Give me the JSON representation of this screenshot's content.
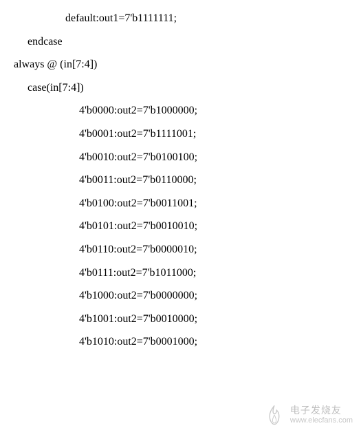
{
  "code": {
    "lines": [
      {
        "indent": 3,
        "text": "default:out1=7'b1111111;"
      },
      {
        "indent": 2,
        "text": "endcase"
      },
      {
        "indent": 1,
        "text": "always @ (in[7:4])"
      },
      {
        "indent": 2,
        "text": "case(in[7:4])"
      },
      {
        "indent": 4,
        "text": "4'b0000:out2=7'b1000000;"
      },
      {
        "indent": 4,
        "text": "4'b0001:out2=7'b1111001;"
      },
      {
        "indent": 4,
        "text": "4'b0010:out2=7'b0100100;"
      },
      {
        "indent": 4,
        "text": "4'b0011:out2=7'b0110000;"
      },
      {
        "indent": 4,
        "text": "4'b0100:out2=7'b0011001;"
      },
      {
        "indent": 4,
        "text": "4'b0101:out2=7'b0010010;"
      },
      {
        "indent": 4,
        "text": "4'b0110:out2=7'b0000010;"
      },
      {
        "indent": 4,
        "text": "4'b0111:out2=7'b1011000;"
      },
      {
        "indent": 4,
        "text": "4'b1000:out2=7'b0000000;"
      },
      {
        "indent": 4,
        "text": "4'b1001:out2=7'b0010000;"
      },
      {
        "indent": 4,
        "text": "4'b1010:out2=7'b0001000;"
      }
    ]
  },
  "watermark": {
    "cn": "电子发烧友",
    "url": "www.elecfans.com"
  }
}
